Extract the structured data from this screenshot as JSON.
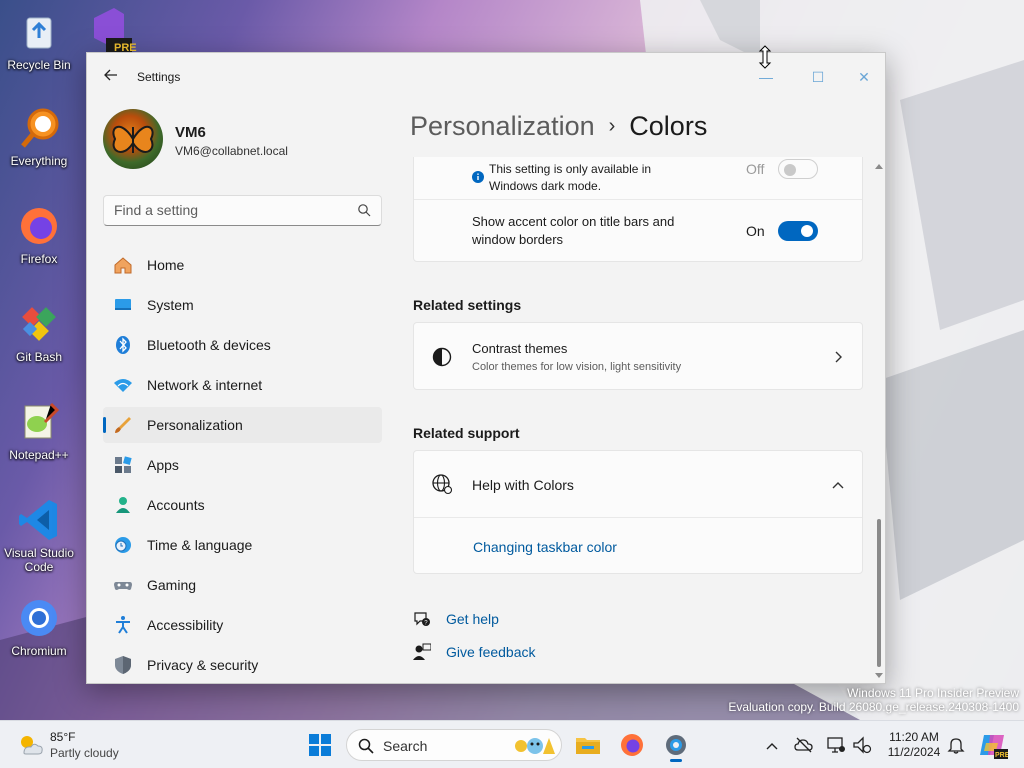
{
  "desktop": {
    "icons": [
      {
        "label": "Recycle Bin",
        "icon": "recycle-bin-icon"
      },
      {
        "label": "Everything",
        "icon": "everything-search-icon"
      },
      {
        "label": "Firefox",
        "icon": "firefox-icon"
      },
      {
        "label": "Git Bash",
        "icon": "git-bash-icon"
      },
      {
        "label": "Notepad++",
        "icon": "notepad-plus-plus-icon"
      },
      {
        "label": "Visual Studio Code",
        "icon": "vscode-icon"
      },
      {
        "label": "Chromium",
        "icon": "chromium-icon"
      }
    ],
    "vs_badge": "PRE"
  },
  "window": {
    "app_title": "Settings",
    "minimize_glyph": "—",
    "maximize_glyph": "☐",
    "close_glyph": "✕"
  },
  "profile": {
    "name": "VM6",
    "email": "VM6@collabnet.local"
  },
  "search": {
    "placeholder": "Find a setting"
  },
  "nav": [
    {
      "label": "Home",
      "icon": "home-icon",
      "active": false
    },
    {
      "label": "System",
      "icon": "system-icon",
      "active": false
    },
    {
      "label": "Bluetooth & devices",
      "icon": "bluetooth-icon",
      "active": false
    },
    {
      "label": "Network & internet",
      "icon": "network-icon",
      "active": false
    },
    {
      "label": "Personalization",
      "icon": "brush-icon",
      "active": true
    },
    {
      "label": "Apps",
      "icon": "apps-icon",
      "active": false
    },
    {
      "label": "Accounts",
      "icon": "accounts-icon",
      "active": false
    },
    {
      "label": "Time & language",
      "icon": "time-language-icon",
      "active": false
    },
    {
      "label": "Gaming",
      "icon": "gaming-icon",
      "active": false
    },
    {
      "label": "Accessibility",
      "icon": "accessibility-icon",
      "active": false
    },
    {
      "label": "Privacy & security",
      "icon": "shield-icon",
      "active": false
    }
  ],
  "breadcrumb": {
    "parent": "Personalization",
    "separator": "›",
    "current": "Colors"
  },
  "settings": {
    "dark_mode_note": {
      "text_line1": "This setting is only available in",
      "text_line2": "Windows dark mode.",
      "toggle_label": "Off",
      "state": "off"
    },
    "accent_title_bars": {
      "text_line1": "Show accent color on title bars and",
      "text_line2": "window borders",
      "toggle_label": "On",
      "state": "on"
    }
  },
  "related_settings": {
    "heading": "Related settings",
    "contrast_title": "Contrast themes",
    "contrast_sub": "Color themes for low vision, light sensitivity"
  },
  "related_support": {
    "heading": "Related support",
    "help_title": "Help with Colors",
    "link": "Changing taskbar color"
  },
  "footer_links": {
    "get_help": "Get help",
    "give_feedback": "Give feedback"
  },
  "watermark": {
    "line1": "Windows 11 Pro Insider Preview",
    "line2": "Evaluation copy. Build 26080.ge_release.240308-1400"
  },
  "taskbar": {
    "weather_temp": "85°F",
    "weather_condition": "Partly cloudy",
    "search_label": "Search",
    "time": "11:20 AM",
    "date": "11/2/2024"
  },
  "colors": {
    "accent": "#0067c0",
    "link": "#005a9e"
  }
}
